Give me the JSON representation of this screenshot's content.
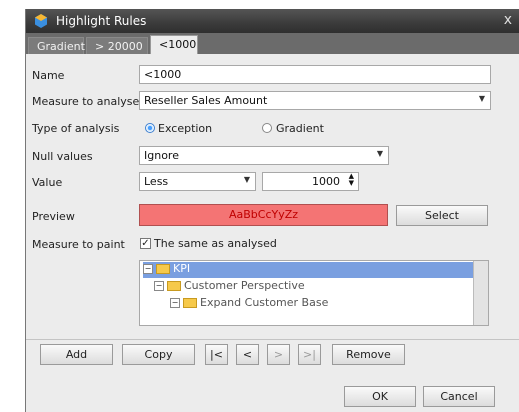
{
  "window": {
    "title": "Highlight Rules",
    "close_glyph": "x"
  },
  "tabs": [
    {
      "label": "Gradient"
    },
    {
      "label": "> 20000"
    },
    {
      "label": "<1000"
    }
  ],
  "form": {
    "name_label": "Name",
    "name_value": "<1000",
    "measure_label": "Measure to analyse",
    "measure_value": "Reseller Sales Amount",
    "type_label": "Type of analysis",
    "type_exception": "Exception",
    "type_gradient": "Gradient",
    "type_selected": "Exception",
    "null_label": "Null values",
    "null_value": "Ignore",
    "value_label": "Value",
    "value_op": "Less",
    "value_number": "1000",
    "preview_label": "Preview",
    "preview_text": "AaBbCcYyZz",
    "preview_bg": "#f47474",
    "preview_fg": "#c00000",
    "select_button": "Select",
    "paint_label": "Measure to paint",
    "same_as_analysed": "The same as analysed",
    "same_checked": true
  },
  "tree": {
    "items": [
      {
        "label": "KPI",
        "selected": true
      },
      {
        "label": "Customer Perspective"
      },
      {
        "label": "Expand Customer Base"
      }
    ]
  },
  "toolbar": {
    "add": "Add",
    "copy": "Copy",
    "first": "|<",
    "prev": "<",
    "next": ">",
    "last": ">|",
    "remove": "Remove"
  },
  "footer": {
    "ok": "OK",
    "cancel": "Cancel"
  },
  "colors": {
    "titlebar": "#3b3b3b",
    "selection": "#7a9fe0"
  }
}
